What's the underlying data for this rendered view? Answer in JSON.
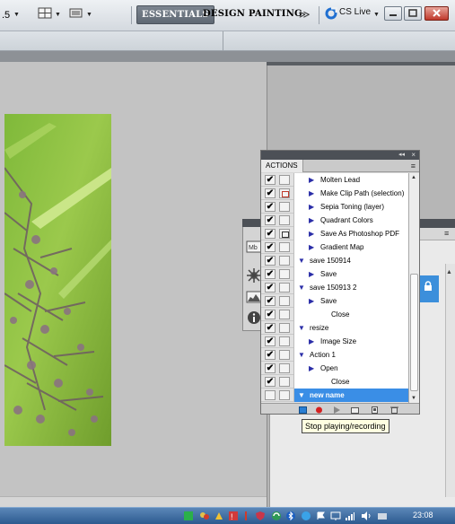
{
  "topbar": {
    "zoom_partial": ".5",
    "workspaces": {
      "essentials": "ESSENTIALS",
      "design": "DESIGN",
      "painting": "PAINTING"
    },
    "more": "≫",
    "cs_live": "CS Live"
  },
  "actions_panel": {
    "tab": "ACTIONS",
    "menu": "≡",
    "collapse": "◂◂",
    "close": "×",
    "rows": [
      {
        "label": "Molten Lead",
        "check": true,
        "dialog": "",
        "indent": 1,
        "expanded": false,
        "selected": false
      },
      {
        "label": "Make Clip Path (selection)",
        "check": true,
        "dialog": "red",
        "indent": 1,
        "expanded": false,
        "selected": false
      },
      {
        "label": "Sepia Toning (layer)",
        "check": true,
        "dialog": "",
        "indent": 1,
        "expanded": false,
        "selected": false
      },
      {
        "label": "Quadrant Colors",
        "check": true,
        "dialog": "",
        "indent": 1,
        "expanded": false,
        "selected": false
      },
      {
        "label": "Save As Photoshop PDF",
        "check": true,
        "dialog": "doc",
        "indent": 1,
        "expanded": false,
        "selected": false
      },
      {
        "label": "Gradient Map",
        "check": true,
        "dialog": "",
        "indent": 1,
        "expanded": false,
        "selected": false
      },
      {
        "label": "save 150914",
        "check": true,
        "dialog": "",
        "indent": 0,
        "expanded": true,
        "selected": false
      },
      {
        "label": "Save",
        "check": true,
        "dialog": "",
        "indent": 1,
        "expanded": false,
        "selected": false
      },
      {
        "label": "save 150913 2",
        "check": true,
        "dialog": "",
        "indent": 0,
        "expanded": true,
        "selected": false
      },
      {
        "label": "Save",
        "check": true,
        "dialog": "",
        "indent": 1,
        "expanded": false,
        "selected": false
      },
      {
        "label": "Close",
        "check": true,
        "dialog": "",
        "indent": 2,
        "expanded": null,
        "selected": false
      },
      {
        "label": "resize",
        "check": true,
        "dialog": "",
        "indent": 0,
        "expanded": true,
        "selected": false
      },
      {
        "label": "Image Size",
        "check": true,
        "dialog": "",
        "indent": 1,
        "expanded": false,
        "selected": false
      },
      {
        "label": "Action 1",
        "check": true,
        "dialog": "",
        "indent": 0,
        "expanded": true,
        "selected": false
      },
      {
        "label": "Open",
        "check": true,
        "dialog": "",
        "indent": 1,
        "expanded": false,
        "selected": false
      },
      {
        "label": "Close",
        "check": true,
        "dialog": "",
        "indent": 2,
        "expanded": null,
        "selected": false
      },
      {
        "label": "new name",
        "check": false,
        "dialog": "",
        "indent": 0,
        "expanded": true,
        "selected": true
      }
    ],
    "bottom_buttons": [
      "stop-icon",
      "record-icon",
      "play-icon",
      "new-set-icon",
      "new-action-icon",
      "delete-icon"
    ]
  },
  "tooltip": "Stop playing/recording",
  "taskbar": {
    "clock": "23:08"
  },
  "colors": {
    "selection": "#3a8ee6",
    "taskbar": "#2c5a8f",
    "record": "#d42020"
  }
}
